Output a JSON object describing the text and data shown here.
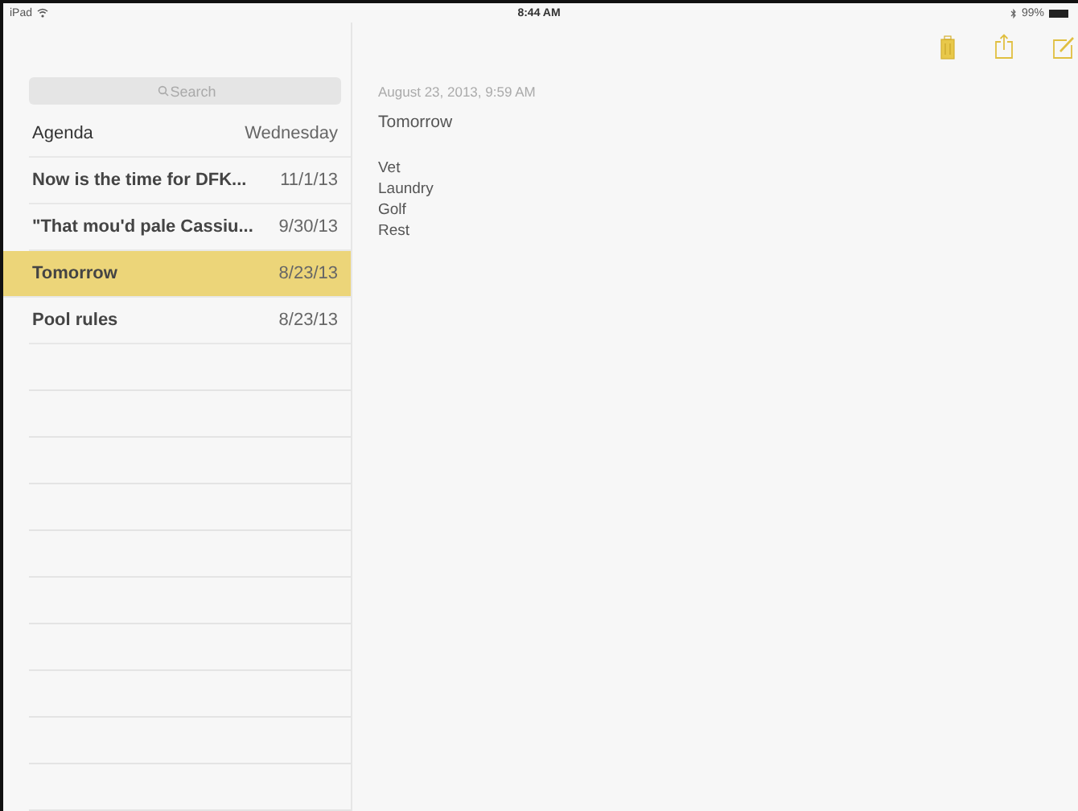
{
  "status_bar": {
    "device": "iPad",
    "time": "8:44 AM",
    "battery": "99%"
  },
  "search": {
    "placeholder": "Search"
  },
  "notes": [
    {
      "title": "Agenda",
      "date": "Wednesday",
      "selected": false
    },
    {
      "title": "Now is the time for DFK...",
      "date": "11/1/13",
      "selected": false
    },
    {
      "title": "\"That mou'd pale Cassiu...",
      "date": "9/30/13",
      "selected": false
    },
    {
      "title": "Tomorrow",
      "date": "8/23/13",
      "selected": true
    },
    {
      "title": "Pool rules",
      "date": "8/23/13",
      "selected": false
    }
  ],
  "note": {
    "timestamp": "August 23, 2013, 9:59 AM",
    "title": "Tomorrow",
    "lines": [
      "Vet",
      "Laundry",
      "Golf",
      "Rest"
    ]
  }
}
